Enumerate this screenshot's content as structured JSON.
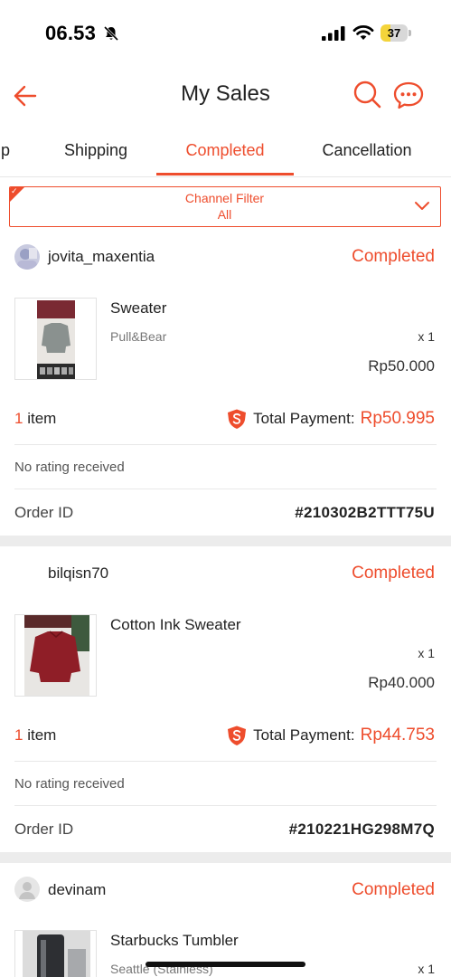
{
  "status_bar": {
    "time": "06.53",
    "battery": "37",
    "battery_level_percent": 37
  },
  "header": {
    "title": "My Sales",
    "back_icon": "back-arrow-icon",
    "search_icon": "search-icon",
    "chat_icon": "chat-icon"
  },
  "tabs": [
    {
      "label": "p",
      "active": false
    },
    {
      "label": "Shipping",
      "active": false
    },
    {
      "label": "Completed",
      "active": true
    },
    {
      "label": "Cancellation",
      "active": false
    }
  ],
  "filter": {
    "title": "Channel Filter",
    "value": "All"
  },
  "orders": [
    {
      "buyer": "jovita_maxentia",
      "status": "Completed",
      "product_name": "Sweater",
      "variant": "Pull&Bear",
      "qty": "x 1",
      "price": "Rp50.000",
      "item_count_num": "1",
      "item_count_word": " item",
      "payment_label": "Total Payment:",
      "payment_value": "Rp50.995",
      "rating": "No rating received",
      "order_id_label": "Order ID",
      "order_id": "#210302B2TTT75U"
    },
    {
      "buyer": "bilqisn70",
      "status": "Completed",
      "product_name": "Cotton Ink Sweater",
      "variant": "",
      "qty": "x 1",
      "price": "Rp40.000",
      "item_count_num": "1",
      "item_count_word": " item",
      "payment_label": "Total Payment:",
      "payment_value": "Rp44.753",
      "rating": "No rating received",
      "order_id_label": "Order ID",
      "order_id": "#210221HG298M7Q"
    },
    {
      "buyer": "devinam",
      "status": "Completed",
      "product_name": "Starbucks Tumbler",
      "variant": "Seattle (Stainless)",
      "qty": "x 1"
    }
  ],
  "colors": {
    "accent": "#ee4d2d",
    "separator": "#ececec"
  }
}
